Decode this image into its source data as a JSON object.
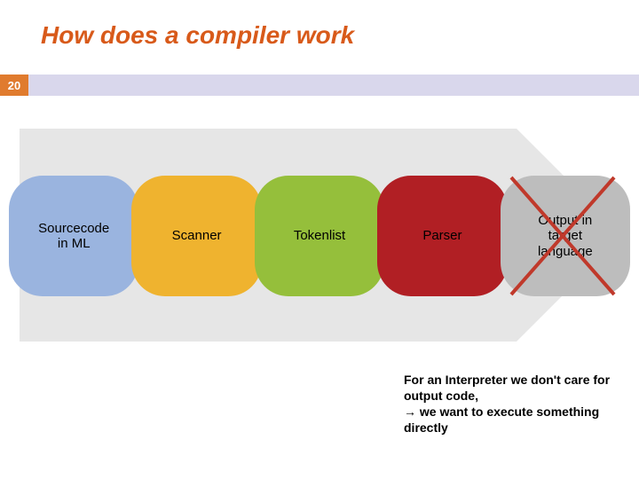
{
  "title": "How does a compiler work",
  "slide_number": "20",
  "stages": [
    {
      "label": "Sourcecode\nin ML"
    },
    {
      "label": "Scanner"
    },
    {
      "label": "Tokenlist"
    },
    {
      "label": "Parser"
    },
    {
      "label": "Output in\ntarget\nlanguage"
    }
  ],
  "caption": {
    "line1": "For an Interpreter we don't care for output code,",
    "arrow": "→",
    "line2": " we want to execute something directly"
  }
}
